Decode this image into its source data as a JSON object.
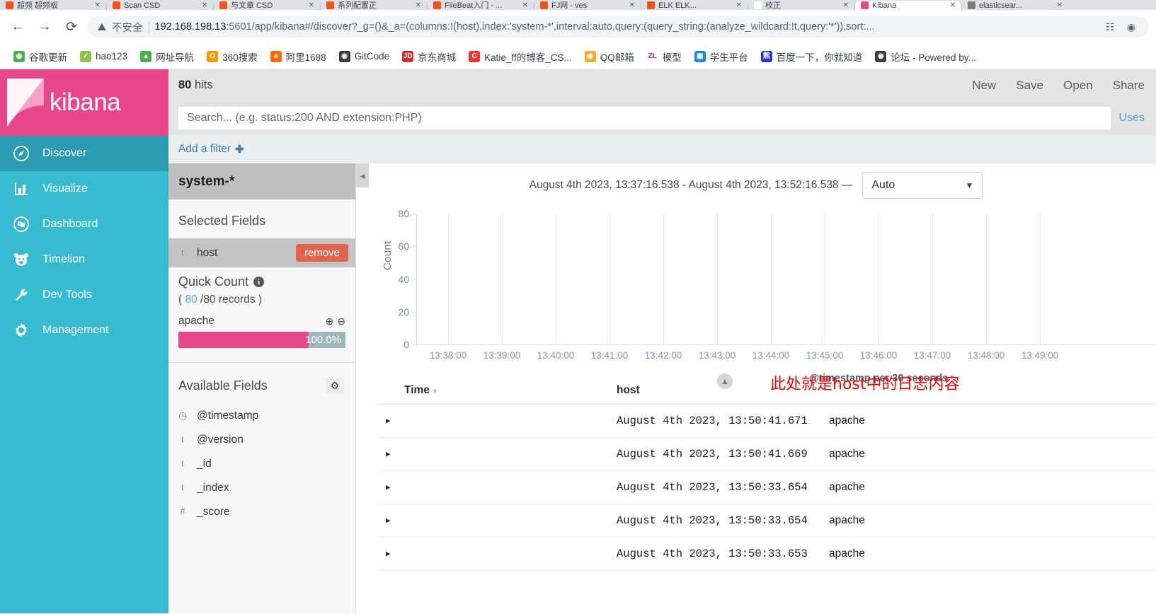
{
  "browser": {
    "tabs": [
      {
        "title": "超频 超频板",
        "favicon_color": "#f4511e",
        "favicon_glyph": "●"
      },
      {
        "title": "Scan  CSD",
        "favicon_color": "#f4511e",
        "favicon_glyph": "●"
      },
      {
        "title": "与文章  CSD",
        "favicon_color": "#f4511e",
        "favicon_glyph": "●"
      },
      {
        "title": "系列配置正",
        "favicon_color": "#f4511e",
        "favicon_glyph": "●"
      },
      {
        "title": "FileBeat入门 - ...",
        "favicon_color": "#f4511e",
        "favicon_glyph": "●"
      },
      {
        "title": "FJ网 - ves",
        "favicon_color": "#f4511e",
        "favicon_glyph": "●"
      },
      {
        "title": "ELK  ELK...",
        "favicon_color": "#f4511e",
        "favicon_glyph": "●"
      },
      {
        "title": "校正",
        "favicon_color": "#ffffff",
        "favicon_glyph": ""
      },
      {
        "title": "Kibana",
        "favicon_color": "#e8488b",
        "favicon_glyph": "",
        "active": true
      },
      {
        "title": "elasticsear...",
        "favicon_color": "#7d7d7d",
        "favicon_glyph": "●"
      }
    ],
    "nav": {
      "back_icon": "back-arrow-icon",
      "forward_icon": "forward-arrow-icon",
      "reload_icon": "reload-icon"
    },
    "omnibox": {
      "security_label": "不安全",
      "url_host": "192.168.198.13",
      "url_rest": ":5601/app/kibana#/discover?_g=()&_a=(columns:!(host),index:'system-*',interval:auto,query:(query_string:(analyze_wildcard:!t,query:'*')),sort:...",
      "translate_icon": "translate-icon",
      "extension_icon": "extension-icon"
    },
    "bookmarks": [
      {
        "label": "谷歌更新",
        "icon": "chrome-icon",
        "color": "#4caf50",
        "glyph": "◉"
      },
      {
        "label": "hao123",
        "icon": "hao123-icon",
        "color": "#8bc34a",
        "glyph": "✓"
      },
      {
        "label": "网址导航",
        "icon": "nav-2345-icon",
        "color": "#4caf50",
        "glyph": "▲"
      },
      {
        "label": "360搜索",
        "icon": "so360-icon",
        "color": "#ff9800",
        "glyph": "O"
      },
      {
        "label": "阿里1688",
        "icon": "alibaba-icon",
        "color": "#ff6a00",
        "glyph": "a"
      },
      {
        "label": "GitCode",
        "icon": "gitcode-icon",
        "color": "#3c3c3c",
        "glyph": "◉"
      },
      {
        "label": "京东商城",
        "icon": "jd-icon",
        "color": "#d32f2f",
        "glyph": "JD"
      },
      {
        "label": "Katie_ff的博客_CS...",
        "icon": "csdn-icon",
        "color": "#e53935",
        "glyph": "C"
      },
      {
        "label": "QQ邮箱",
        "icon": "qqmail-icon",
        "color": "#ffa726",
        "glyph": "◉"
      },
      {
        "label": "模型",
        "icon": "zl-icon",
        "color": "#ffffff",
        "glyph": "ZL"
      },
      {
        "label": "学生平台",
        "icon": "student-icon",
        "color": "#1e88e5",
        "glyph": "▣"
      },
      {
        "label": "百度一下，你就知道",
        "icon": "baidu-icon",
        "color": "#2932e1",
        "glyph": "熊"
      },
      {
        "label": "论坛 - Powered by...",
        "icon": "forum-icon",
        "color": "#3c3c3c",
        "glyph": "◉"
      }
    ]
  },
  "kibana": {
    "brand": "kibana",
    "brand_bg": "#e8488b",
    "sidebar_bg": "#37bbd1",
    "nav": [
      {
        "label": "Discover",
        "icon": "compass-icon",
        "active": true
      },
      {
        "label": "Visualize",
        "icon": "bar-chart-icon",
        "active": false
      },
      {
        "label": "Dashboard",
        "icon": "dashboard-icon",
        "active": false
      },
      {
        "label": "Timelion",
        "icon": "timelion-bear-icon",
        "active": false
      },
      {
        "label": "Dev Tools",
        "icon": "wrench-icon",
        "active": false
      },
      {
        "label": "Management",
        "icon": "gear-icon",
        "active": false
      }
    ],
    "topbar": {
      "hits_count": "80",
      "hits_label": "hits",
      "actions": [
        "New",
        "Save",
        "Open",
        "Share"
      ]
    },
    "search": {
      "value": "",
      "placeholder": "Search... (e.g. status:200 AND extension:PHP)",
      "uses_link": "Uses"
    },
    "filter": {
      "add_filter_label": "Add a filter",
      "plus_glyph": "✚"
    },
    "fields_panel": {
      "index_pattern": "system-*",
      "selected_fields_title": "Selected Fields",
      "selected_fields": [
        {
          "type": "t",
          "name": "host",
          "remove_label": "remove"
        }
      ],
      "quick_count": {
        "title": "Quick Count",
        "info_glyph": "i",
        "records_prefix": "(",
        "records_count": "80",
        "records_total": "/80 records",
        "records_suffix": ")"
      },
      "bucket": {
        "name": "apache",
        "percent_label": "100.0%",
        "percent_value": 100,
        "zoom_in_icon": "magnify-plus-icon",
        "zoom_out_icon": "magnify-minus-icon"
      },
      "available_fields_title": "Available Fields",
      "settings_icon": "gear-icon",
      "available_fields": [
        {
          "type": "◷",
          "name": "@timestamp"
        },
        {
          "type": "t",
          "name": "@version"
        },
        {
          "type": "t",
          "name": "_id"
        },
        {
          "type": "t",
          "name": "_index"
        },
        {
          "type": "#",
          "name": "_score"
        }
      ]
    },
    "time_range": {
      "text": "August 4th 2023, 13:37:16.538 - August 4th 2023, 13:52:16.538 —",
      "interval_value": "Auto",
      "collapse_icon": "chevron-left-icon"
    },
    "annotation": "此处就是host中的日志内容",
    "expand_icon": "chevron-up-icon",
    "doc_table": {
      "columns": [
        {
          "label": "Time",
          "sortable": true,
          "sort_caret": "▾"
        },
        {
          "label": "host",
          "sortable": false
        }
      ],
      "rows": [
        {
          "caret": "▶",
          "time": "August 4th 2023, 13:50:41.671",
          "host": "apache"
        },
        {
          "caret": "▶",
          "time": "August 4th 2023, 13:50:41.669",
          "host": "apache"
        },
        {
          "caret": "▶",
          "time": "August 4th 2023, 13:50:33.654",
          "host": "apache"
        },
        {
          "caret": "▶",
          "time": "August 4th 2023, 13:50:33.654",
          "host": "apache"
        },
        {
          "caret": "▶",
          "time": "August 4th 2023, 13:50:33.653",
          "host": "apache"
        }
      ]
    }
  },
  "chart_data": {
    "type": "bar",
    "title": "",
    "xlabel": "@timestamp per 30 seconds",
    "ylabel": "Count",
    "ylim": [
      0,
      80
    ],
    "yticks": [
      0,
      20,
      40,
      60,
      80
    ],
    "categories": [
      "13:38:00",
      "13:39:00",
      "13:40:00",
      "13:41:00",
      "13:42:00",
      "13:43:00",
      "13:44:00",
      "13:45:00",
      "13:46:00",
      "13:47:00",
      "13:48:00",
      "13:49:00"
    ],
    "values": [
      0,
      0,
      0,
      0,
      0,
      0,
      0,
      0,
      0,
      0,
      0,
      0
    ],
    "grid": false,
    "legend": "none",
    "note": "no bars visible within the rendered x-range; data falls outside visible area"
  }
}
